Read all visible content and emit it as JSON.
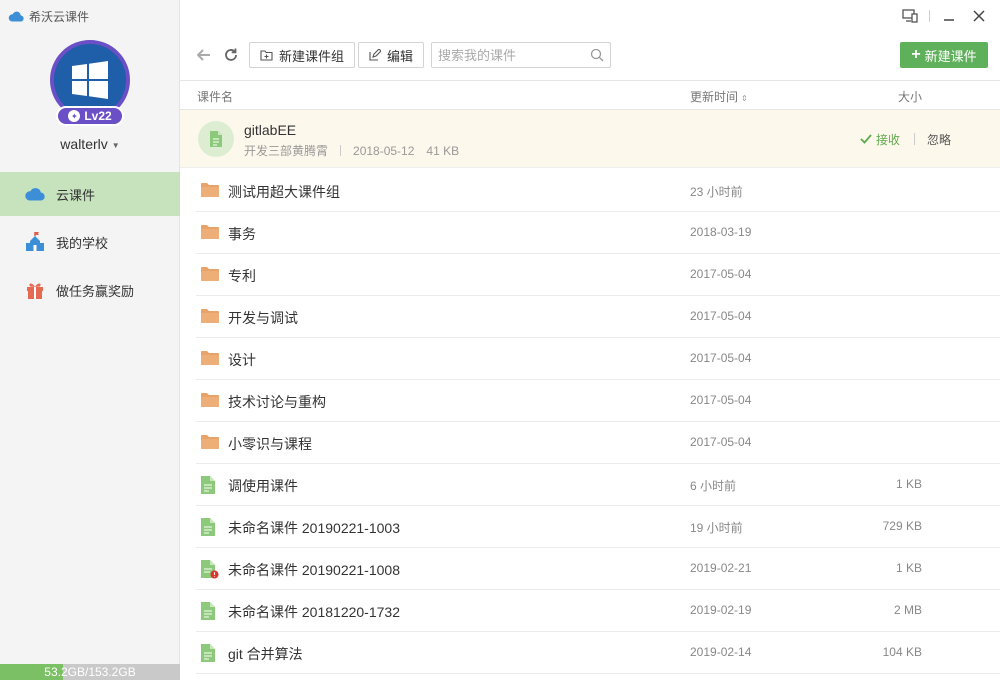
{
  "app": {
    "title": "希沃云课件"
  },
  "user": {
    "name": "walterlv",
    "level": "Lv22"
  },
  "sidebar": {
    "items": [
      {
        "label": "云课件",
        "icon": "cloud-icon",
        "active": true
      },
      {
        "label": "我的学校",
        "icon": "school-icon",
        "active": false
      },
      {
        "label": "做任务赢奖励",
        "icon": "gift-icon",
        "active": false
      }
    ],
    "storage": {
      "label": "53.2GB/153.2GB",
      "used_gb": 53.2,
      "total_gb": 153.2
    }
  },
  "window_controls": [
    "screen-mirror-icon",
    "minimize-icon",
    "close-icon"
  ],
  "toolbar": {
    "back_icon": "back-arrow-icon",
    "refresh_icon": "refresh-icon",
    "new_group_label": "新建课件组",
    "edit_label": "编辑",
    "search_placeholder": "搜索我的课件",
    "new_courseware_label": "新建课件"
  },
  "table": {
    "headers": {
      "name": "课件名",
      "time": "更新时间",
      "size": "大小"
    }
  },
  "pending": {
    "name": "gitlabEE",
    "sender": "开发三部黄腾霄",
    "date": "2018-05-12",
    "size": "41 KB",
    "accept_label": "接收",
    "ignore_label": "忽略"
  },
  "files": [
    {
      "type": "folder",
      "name": "测试用超大课件组",
      "time": "23 小时前",
      "size": ""
    },
    {
      "type": "folder",
      "name": "事务",
      "time": "2018-03-19",
      "size": ""
    },
    {
      "type": "folder",
      "name": "专利",
      "time": "2017-05-04",
      "size": ""
    },
    {
      "type": "folder",
      "name": "开发与调试",
      "time": "2017-05-04",
      "size": ""
    },
    {
      "type": "folder",
      "name": "设计",
      "time": "2017-05-04",
      "size": ""
    },
    {
      "type": "folder",
      "name": "技术讨论与重构",
      "time": "2017-05-04",
      "size": ""
    },
    {
      "type": "folder",
      "name": "小零识与课程",
      "time": "2017-05-04",
      "size": ""
    },
    {
      "type": "file",
      "name": "调使用课件",
      "time": "6 小时前",
      "size": "1 KB"
    },
    {
      "type": "file",
      "name": "未命名课件 20190221-1003",
      "time": "19 小时前",
      "size": "729 KB"
    },
    {
      "type": "file-error",
      "name": "未命名课件 20190221-1008",
      "time": "2019-02-21",
      "size": "1 KB"
    },
    {
      "type": "file",
      "name": "未命名课件 20181220-1732",
      "time": "2019-02-19",
      "size": "2 MB"
    },
    {
      "type": "file",
      "name": "git 合并算法",
      "time": "2019-02-14",
      "size": "104 KB"
    }
  ],
  "colors": {
    "accent_green": "#5fb05a",
    "active_nav": "#c6e3bd",
    "folder": "#e8a36a",
    "file": "#8cc97a",
    "badge_purple": "#6b4fc6"
  }
}
